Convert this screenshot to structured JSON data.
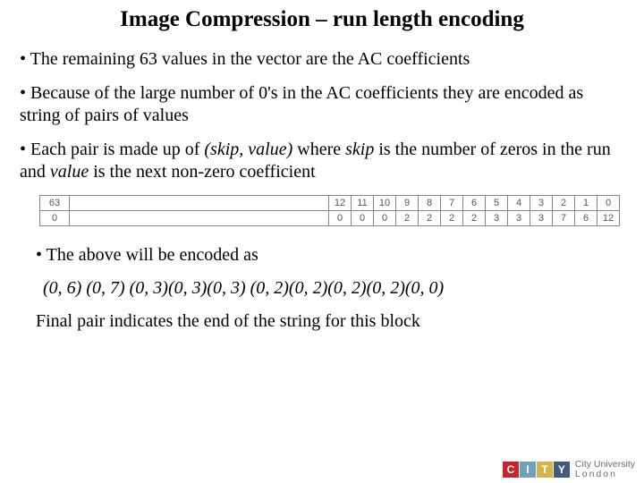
{
  "title": "Image Compression – run length encoding",
  "bullets": {
    "b1": "• The remaining 63 values in the vector are the AC coefficients",
    "b2": "• Because of the large number of 0's in the AC coefficients they are encoded as string of pairs of values",
    "b3_pre": "• Each pair is made up of ",
    "b3_pair": "(skip, value)",
    "b3_mid1": " where ",
    "b3_skip": "skip",
    "b3_mid2": " is the number of zeros in the run and ",
    "b3_value": "value",
    "b3_post": " is the next non-zero coefficient",
    "b4": "• The above will be encoded as",
    "b5": "Final pair indicates the end of the string for this block"
  },
  "table": {
    "row1_label": "63",
    "row1": [
      "12",
      "11",
      "10",
      "9",
      "8",
      "7",
      "6",
      "5",
      "4",
      "3",
      "2",
      "1",
      "0"
    ],
    "row2_label": "0",
    "row2": [
      "0",
      "0",
      "0",
      "2",
      "2",
      "2",
      "2",
      "3",
      "3",
      "3",
      "7",
      "6",
      "12"
    ]
  },
  "encoded": "(0, 6) (0, 7) (0, 3)(0, 3)(0, 3) (0, 2)(0, 2)(0, 2)(0, 2)(0, 0)",
  "logo": {
    "letters": [
      "C",
      "I",
      "T",
      "Y"
    ],
    "line1": "City University",
    "line2": "London"
  }
}
